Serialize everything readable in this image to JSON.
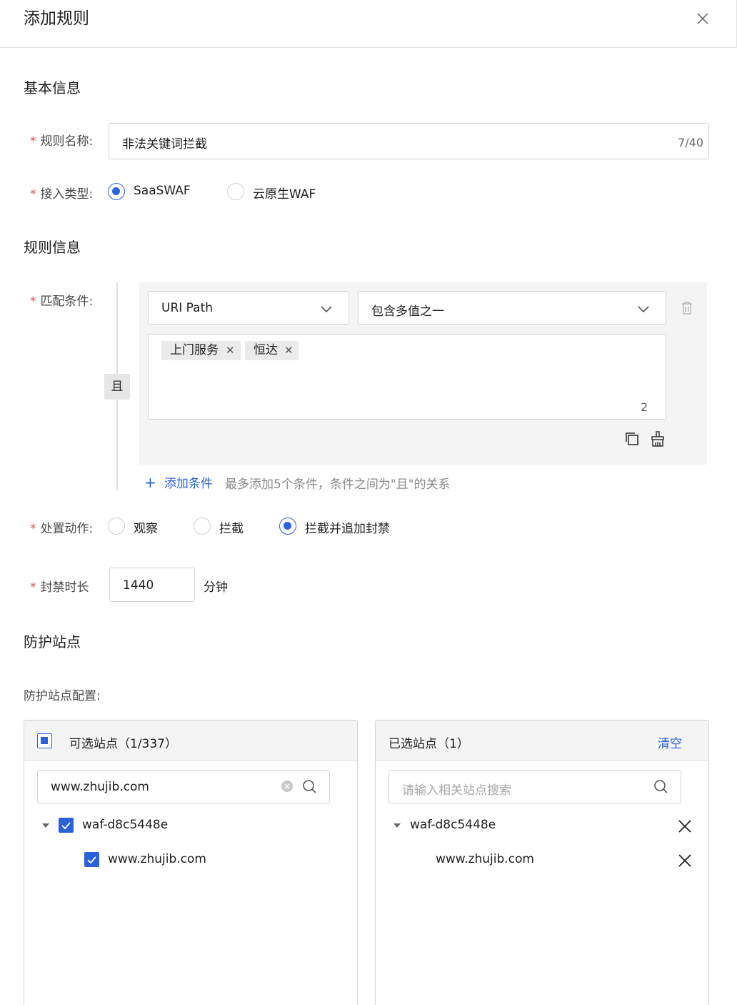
{
  "dialog": {
    "title": "添加规则"
  },
  "basic": {
    "section_title": "基本信息",
    "rule_name": {
      "label": "规则名称:",
      "value": "非法关键词拦截",
      "counter": "7/40"
    },
    "access_type": {
      "label": "接入类型:",
      "options": [
        "SaaSWAF",
        "云原生WAF"
      ],
      "selected": "SaaSWAF"
    }
  },
  "rule_info": {
    "section_title": "规则信息",
    "match": {
      "label": "匹配条件:",
      "logic": "且",
      "field": "URI Path",
      "operator": "包含多值之一",
      "tags": [
        "上门服务",
        "恒达"
      ],
      "tag_count": "2",
      "add_label": "添加条件",
      "add_hint": "最多添加5个条件，条件之间为\"且\"的关系"
    },
    "action": {
      "label": "处置动作:",
      "options": [
        "观察",
        "拦截",
        "拦截并追加封禁"
      ],
      "selected": "拦截并追加封禁"
    },
    "ban": {
      "label": "封禁时长",
      "value": "1440",
      "unit": "分钟"
    }
  },
  "protect": {
    "section_title": "防护站点",
    "config_label": "防护站点配置:",
    "available": {
      "title": "可选站点（1/337）",
      "search_value": "www.zhujib.com",
      "group": "waf-d8c5448e",
      "item": "www.zhujib.com"
    },
    "selected": {
      "title": "已选站点（1）",
      "clear_label": "清空",
      "search_placeholder": "请输入相关站点搜索",
      "group": "waf-d8c5448e",
      "item": "www.zhujib.com"
    }
  },
  "colors": {
    "primary": "#2b62d9",
    "required": "#e5484d"
  }
}
